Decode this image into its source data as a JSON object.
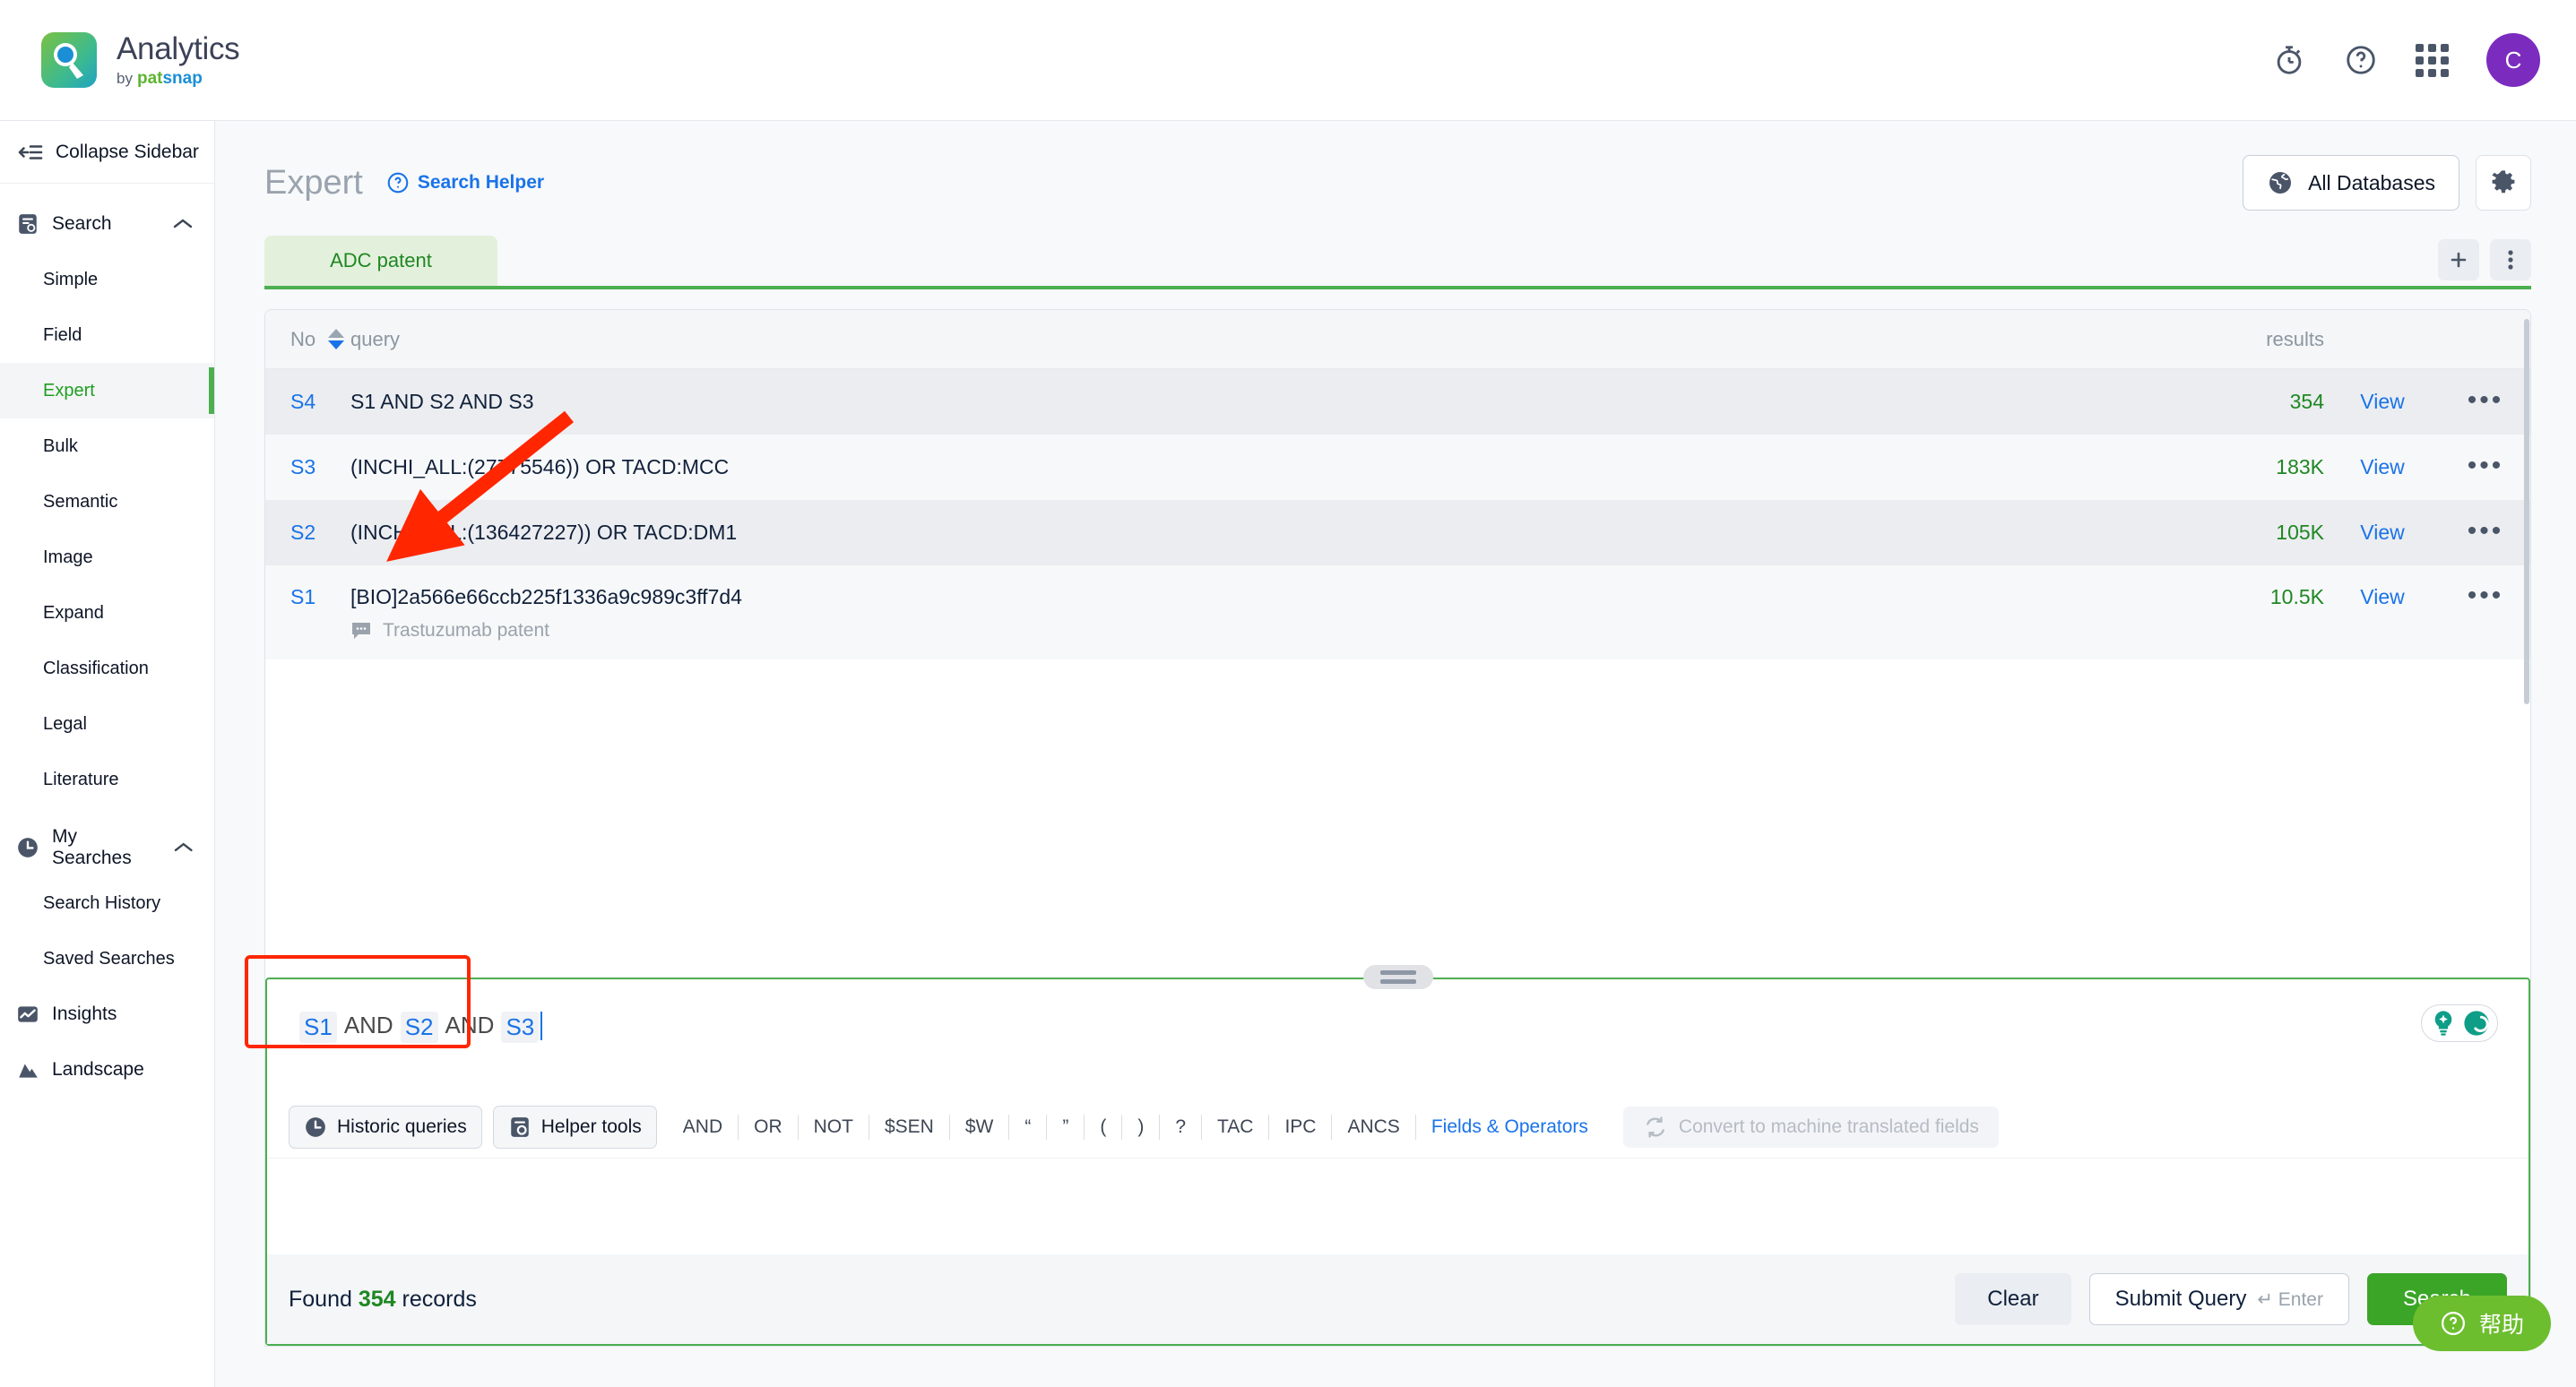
{
  "app": {
    "logo_title": "Analytics",
    "logo_by": "by",
    "logo_brand_green": "pat",
    "logo_brand_blue": "snap"
  },
  "topbar": {
    "icons": [
      {
        "name": "stopwatch-icon",
        "label": "Stopwatch"
      },
      {
        "name": "help-circle-icon",
        "label": "Help"
      },
      {
        "name": "apps-grid-icon",
        "label": "Apps"
      }
    ],
    "avatar_initial": "C"
  },
  "sidebar": {
    "collapse_label": "Collapse Sidebar",
    "groups": [
      {
        "label": "Search",
        "icon": "search-doc-icon",
        "expanded": true,
        "items": [
          {
            "label": "Simple",
            "active": false
          },
          {
            "label": "Field",
            "active": false
          },
          {
            "label": "Expert",
            "active": true
          },
          {
            "label": "Bulk",
            "active": false
          },
          {
            "label": "Semantic",
            "active": false
          },
          {
            "label": "Image",
            "active": false
          },
          {
            "label": "Expand",
            "active": false
          },
          {
            "label": "Classification",
            "active": false
          },
          {
            "label": "Legal",
            "active": false
          },
          {
            "label": "Literature",
            "active": false
          }
        ]
      },
      {
        "label": "My Searches",
        "icon": "clock-icon",
        "expanded": true,
        "items": [
          {
            "label": "Search History",
            "active": false
          },
          {
            "label": "Saved Searches",
            "active": false
          }
        ]
      },
      {
        "label": "Insights",
        "icon": "chart-icon",
        "expanded": false,
        "items": []
      },
      {
        "label": "Landscape",
        "icon": "landscape-icon",
        "expanded": false,
        "items": []
      }
    ]
  },
  "main": {
    "page_title": "Expert",
    "search_helper_label": "Search Helper",
    "databases_label": "All Databases",
    "settings_icon": "gear-icon",
    "add_tab_icon": "plus-icon",
    "tab_more_icon": "kebab-menu-icon",
    "tabs": [
      {
        "label": "ADC patent",
        "active": true
      }
    ],
    "table": {
      "headers": {
        "no": "No",
        "query": "query",
        "results": "results"
      },
      "view_label": "View",
      "more_label": "•••",
      "rows": [
        {
          "no": "S4",
          "query": "S1 AND S2 AND S3",
          "note": "",
          "results": "354"
        },
        {
          "no": "S3",
          "query": "(INCHI_ALL:(27775546)) OR TACD:MCC",
          "note": "",
          "results": "183K"
        },
        {
          "no": "S2",
          "query": "(INCHI_ALL:(136427227)) OR TACD:DM1",
          "note": "",
          "results": "105K"
        },
        {
          "no": "S1",
          "query": "[BIO]2a566e66ccb225f1336a9c989c3ff7d4",
          "note": "Trastuzumab patent",
          "results": "10.5K"
        }
      ]
    },
    "editor": {
      "tokens": [
        {
          "type": "chip",
          "text": "S1"
        },
        {
          "type": "op",
          "text": "AND"
        },
        {
          "type": "chip",
          "text": "S2"
        },
        {
          "type": "op",
          "text": "AND"
        },
        {
          "type": "chip",
          "text": "S3"
        }
      ],
      "ai_icons": [
        {
          "name": "lightbulb-sparkle-icon"
        },
        {
          "name": "ai-assist-icon"
        }
      ],
      "toolbar": {
        "historic_queries_label": "Historic queries",
        "helper_tools_label": "Helper tools",
        "operators": [
          "AND",
          "OR",
          "NOT",
          "$SEN",
          "$W",
          "“",
          "”",
          "(",
          ")",
          "?",
          "TAC",
          "IPC",
          "ANCS"
        ],
        "fields_operators_label": "Fields & Operators",
        "convert_label": "Convert to machine translated fields"
      },
      "footer": {
        "found_prefix": "Found",
        "found_count": "354",
        "found_suffix": "records",
        "clear_label": "Clear",
        "submit_label": "Submit Query",
        "submit_hint": "↵ Enter",
        "search_label": "Search"
      }
    }
  },
  "help_fab": {
    "label": "帮助"
  },
  "colors": {
    "brand_green": "#4caf50",
    "search_green": "#3aa527",
    "link_blue": "#1a73e8",
    "result_green": "#1f8722",
    "annotation_red": "#ff2600",
    "avatar_purple": "#7b2cbf",
    "tab_bg": "#e3f1dc"
  }
}
